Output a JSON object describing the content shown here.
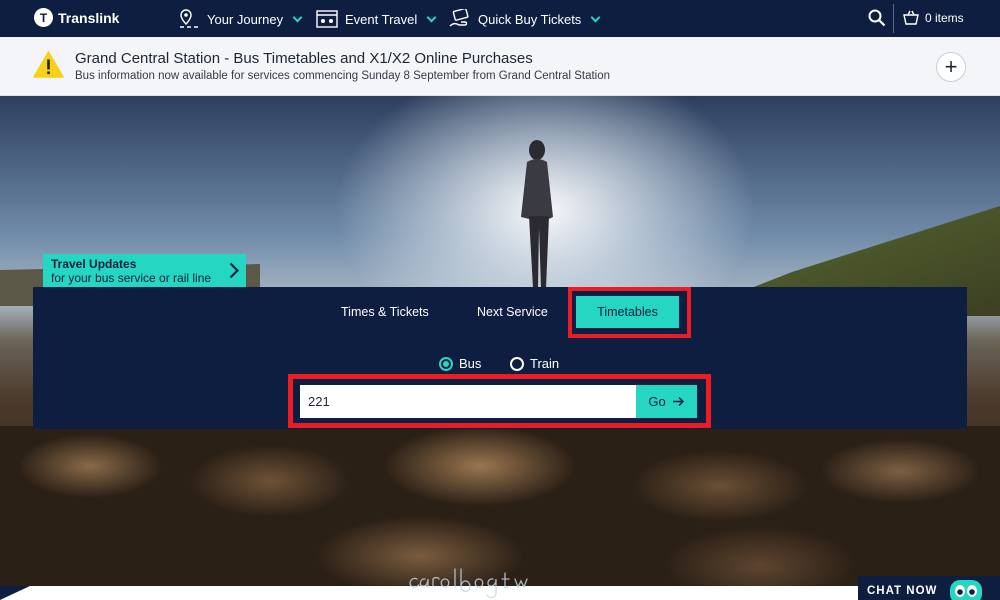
{
  "nav": {
    "brand": "Translink",
    "brand_letter": "T",
    "items": [
      {
        "label": "Your Journey",
        "icon": "route-pin-icon"
      },
      {
        "label": "Event Travel",
        "icon": "stage-icon"
      },
      {
        "label": "Quick Buy Tickets",
        "icon": "ticket-hand-icon"
      }
    ],
    "basket": "0 items"
  },
  "alert": {
    "title": "Grand Central Station - Bus Timetables and X1/X2 Online Purchases",
    "subtitle": "Bus information now available for services commencing Sunday 8 September from Grand Central Station",
    "expand_symbol": "+"
  },
  "travel_updates": {
    "title": "Travel Updates",
    "subtitle": "for your bus service or rail line"
  },
  "planner": {
    "tabs": [
      "Times & Tickets",
      "Next Service",
      "Timetables"
    ],
    "active_tab": "Timetables",
    "modes": [
      "Bus",
      "Train"
    ],
    "selected_mode": "Bus",
    "search_value": "221",
    "go_label": "Go"
  },
  "chat": {
    "label": "CHAT NOW"
  },
  "watermark": "carolblogtw",
  "colors": {
    "navy": "#0e1e40",
    "teal": "#25d7c2",
    "highlight_red": "#ec1c24",
    "alert_yellow": "#f7d117"
  }
}
